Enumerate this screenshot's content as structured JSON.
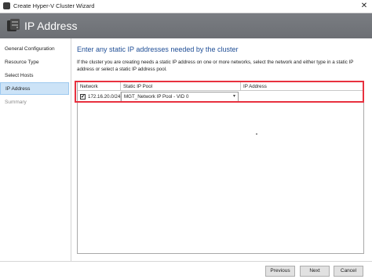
{
  "window": {
    "title": "Create Hyper-V Cluster Wizard",
    "close_glyph": "✕"
  },
  "header": {
    "title": "IP Address"
  },
  "sidebar": {
    "items": [
      {
        "label": "General Configuration"
      },
      {
        "label": "Resource Type"
      },
      {
        "label": "Select Hosts"
      },
      {
        "label": "IP Address"
      },
      {
        "label": "Summary"
      }
    ]
  },
  "main": {
    "heading": "Enter any static IP addresses needed by the cluster",
    "description": "If the cluster you are creating needs a static IP address on one or more networks, select the network and either type in a static IP address or select a static IP address pool."
  },
  "grid": {
    "columns": [
      "Network",
      "Static IP Pool",
      "IP Address"
    ],
    "rows": [
      {
        "checked": true,
        "network": "172.16.20.0/24",
        "pool": "MGT_Network IP Pool - VID 0",
        "ip": ""
      }
    ]
  },
  "footer": {
    "previous": "Previous",
    "next": "Next",
    "cancel": "Cancel"
  },
  "colors": {
    "header_bg": "#737679",
    "accent_text": "#1f4e96",
    "highlight": "#e8313f",
    "active_nav": "#cce3f7"
  },
  "icons": {
    "app": "hyper-v-server-icon",
    "header": "server-cluster-icon",
    "checkbox": "checkmark-icon",
    "dropdown": "chevron-down-icon"
  }
}
